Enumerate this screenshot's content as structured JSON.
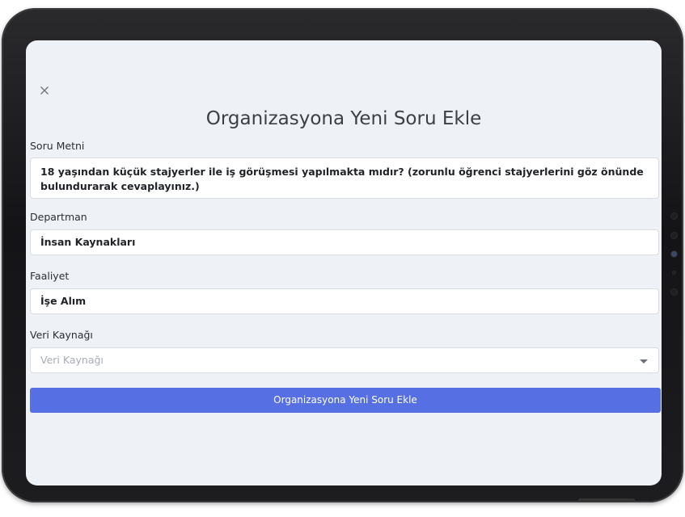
{
  "modal": {
    "title": "Organizasyona Yeni Soru Ekle",
    "close_icon": "close-icon"
  },
  "form": {
    "question": {
      "label": "Soru Metni",
      "value": "18 yaşından küçük stajyerler ile iş görüşmesi yapılmakta mıdır? (zorunlu öğrenci stajyerlerini göz önünde bulundurarak cevaplayınız.)"
    },
    "department": {
      "label": "Departman",
      "value": "İnsan Kaynakları"
    },
    "activity": {
      "label": "Faaliyet",
      "value": "İşe Alım"
    },
    "data_source": {
      "label": "Veri Kaynağı",
      "placeholder": "Veri Kaynağı"
    },
    "submit_label": "Organizasyona Yeni Soru Ekle"
  },
  "colors": {
    "accent": "#5670e4",
    "background": "#eef1f6"
  }
}
